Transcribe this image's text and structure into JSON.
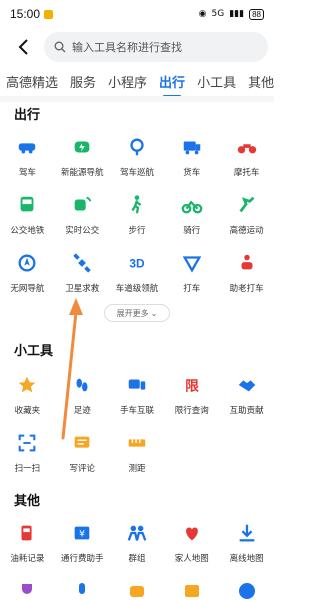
{
  "status": {
    "time": "15:00",
    "signal": "5G",
    "battery": "88"
  },
  "search": {
    "placeholder": "输入工具名称进行查找"
  },
  "tabs": [
    {
      "label": "高德精选",
      "active": false
    },
    {
      "label": "服务",
      "active": false
    },
    {
      "label": "小程序",
      "active": false
    },
    {
      "label": "出行",
      "active": true
    },
    {
      "label": "小工具",
      "active": false
    },
    {
      "label": "其他",
      "active": false
    }
  ],
  "sections": {
    "travel": {
      "title": "出行",
      "items": [
        {
          "label": "驾车",
          "icon": "car-icon",
          "color": "#1a73e8"
        },
        {
          "label": "新能源导航",
          "icon": "ev-charging-icon",
          "color": "#19b56b"
        },
        {
          "label": "驾车巡航",
          "icon": "cruise-icon",
          "color": "#1a73e8"
        },
        {
          "label": "货车",
          "icon": "truck-icon",
          "color": "#1a73e8"
        },
        {
          "label": "摩托车",
          "icon": "motorcycle-icon",
          "color": "#e53935"
        },
        {
          "label": "公交地铁",
          "icon": "bus-icon",
          "color": "#19b56b"
        },
        {
          "label": "实时公交",
          "icon": "realtime-bus-icon",
          "color": "#19b56b"
        },
        {
          "label": "步行",
          "icon": "walk-icon",
          "color": "#19b56b"
        },
        {
          "label": "骑行",
          "icon": "bike-icon",
          "color": "#19b56b"
        },
        {
          "label": "高德运动",
          "icon": "sport-icon",
          "color": "#19b56b"
        },
        {
          "label": "无网导航",
          "icon": "offline-nav-icon",
          "color": "#1a73e8"
        },
        {
          "label": "卫星求救",
          "icon": "satellite-icon",
          "color": "#1a73e8"
        },
        {
          "label": "车道级领航",
          "icon": "lane-3d-icon",
          "color": "#1a73e8"
        },
        {
          "label": "打车",
          "icon": "taxi-icon",
          "color": "#1a73e8"
        },
        {
          "label": "助老打车",
          "icon": "elder-taxi-icon",
          "color": "#e53935"
        }
      ],
      "more_label": "展开更多"
    },
    "tools": {
      "title": "小工具",
      "items": [
        {
          "label": "收藏夹",
          "icon": "star-icon",
          "color": "#f5a623"
        },
        {
          "label": "足迹",
          "icon": "footprint-icon",
          "color": "#1a73e8"
        },
        {
          "label": "手车互联",
          "icon": "car-link-icon",
          "color": "#1a73e8"
        },
        {
          "label": "限行查询",
          "icon": "restriction-icon",
          "color": "#e53935"
        },
        {
          "label": "互助贡献",
          "icon": "handshake-icon",
          "color": "#1a73e8"
        },
        {
          "label": "扫一扫",
          "icon": "scan-icon",
          "color": "#1a73e8"
        },
        {
          "label": "写评论",
          "icon": "comment-icon",
          "color": "#f5a623"
        },
        {
          "label": "测距",
          "icon": "ruler-icon",
          "color": "#f5a623"
        }
      ]
    },
    "other": {
      "title": "其他",
      "items": [
        {
          "label": "油耗记录",
          "icon": "fuel-icon",
          "color": "#e53935"
        },
        {
          "label": "通行费助手",
          "icon": "toll-icon",
          "color": "#1a73e8"
        },
        {
          "label": "群组",
          "icon": "group-icon",
          "color": "#1a73e8"
        },
        {
          "label": "家人地图",
          "icon": "family-map-icon",
          "color": "#e53935"
        },
        {
          "label": "离线地图",
          "icon": "download-icon",
          "color": "#1a73e8"
        }
      ]
    }
  },
  "annotation": {
    "color": "#f08a3c"
  }
}
